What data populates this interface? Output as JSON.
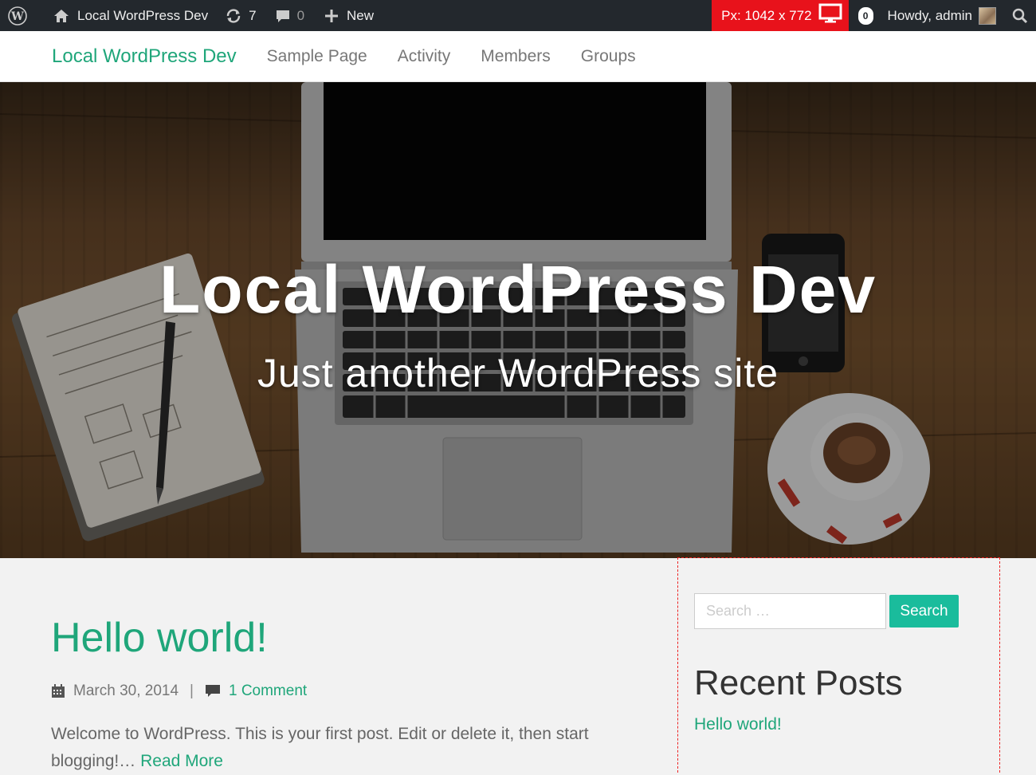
{
  "adminbar": {
    "wp_logo_icon": "wordpress-icon",
    "site_name": "Local WordPress Dev",
    "updates_count": "7",
    "comments_count": "0",
    "new_label": "New",
    "px_label": "Px: 1042 x 772",
    "notification_count": "0",
    "howdy": "Howdy, admin"
  },
  "site_nav": {
    "brand": "Local WordPress Dev",
    "items": [
      {
        "label": "Sample Page"
      },
      {
        "label": "Activity"
      },
      {
        "label": "Members"
      },
      {
        "label": "Groups"
      }
    ]
  },
  "hero": {
    "title": "Local WordPress Dev",
    "tagline": "Just another WordPress site"
  },
  "post": {
    "title": "Hello world!",
    "date": "March 30, 2014",
    "separator": "|",
    "comments": "1 Comment",
    "excerpt": "Welcome to WordPress. This is your first post. Edit or delete it, then start blogging!…",
    "read_more": "Read More"
  },
  "sidebar": {
    "search_placeholder": "Search …",
    "search_button": "Search",
    "recent_posts_title": "Recent Posts",
    "recent_posts": [
      {
        "label": "Hello world!"
      }
    ]
  },
  "colors": {
    "accent": "#1fa67a",
    "button": "#1abc9c",
    "adminbar": "#23282d",
    "px_badge": "#e8121b"
  }
}
